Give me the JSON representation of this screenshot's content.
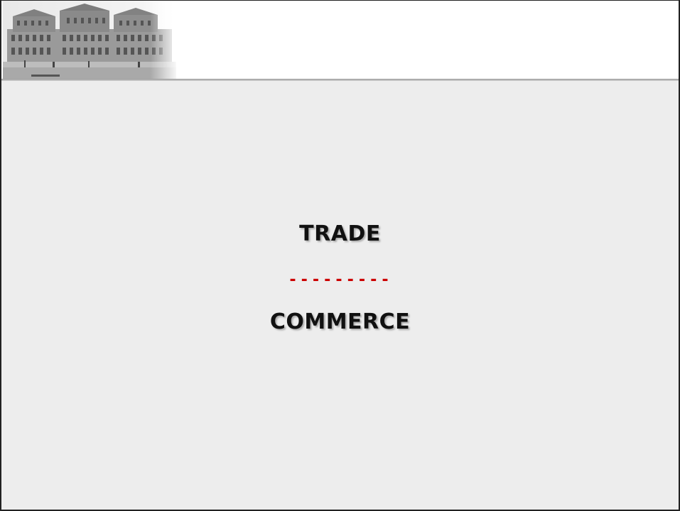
{
  "slide": {
    "line1": "TRADE",
    "separator": "---------",
    "line2": "COMMERCE"
  },
  "colors": {
    "content_background": "#ededed",
    "separator": "#cc0000",
    "text": "#111111"
  },
  "header": {
    "image_icon": "building-photo-icon"
  }
}
